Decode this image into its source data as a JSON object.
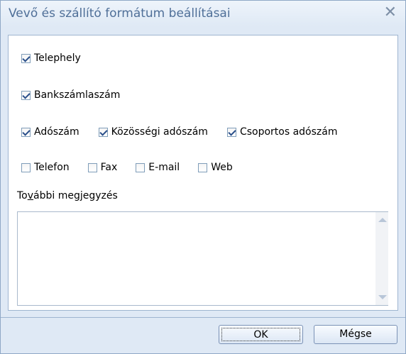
{
  "window": {
    "title": "Vevő és szállító formátum beállításai",
    "close_icon": "close-icon"
  },
  "options": {
    "telephely": {
      "label": "Telephely",
      "checked": true
    },
    "bankszamlaszam": {
      "label": "Bankszámlaszám",
      "checked": true
    },
    "adoszam": {
      "label": "Adószám",
      "checked": true
    },
    "kozossegi_adoszam": {
      "label": "Közösségi adószám",
      "checked": true
    },
    "csoportos_adoszam": {
      "label": "Csoportos adószám",
      "checked": true
    },
    "telefon": {
      "label": "Telefon",
      "checked": false
    },
    "fax": {
      "label": "Fax",
      "checked": false
    },
    "email": {
      "label": "E-mail",
      "checked": false
    },
    "web": {
      "label": "Web",
      "checked": false
    }
  },
  "note": {
    "label_before": "To",
    "label_underlined": "v",
    "label_after": "ábbi megjegyzés",
    "value": ""
  },
  "buttons": {
    "ok": "OK",
    "cancel": "Mégse"
  }
}
